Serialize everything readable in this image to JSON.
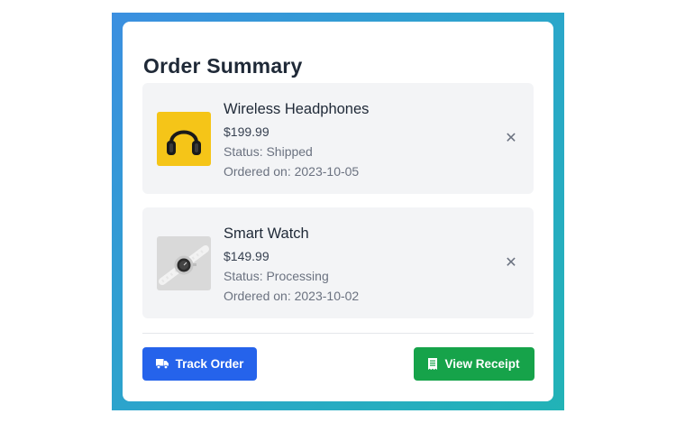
{
  "order_summary": {
    "title": "Order Summary",
    "items": [
      {
        "name": "Wireless Headphones",
        "price": "$199.99",
        "status": "Status: Shipped",
        "ordered_on": "Ordered on: 2023-10-05",
        "image_icon": "headphones-image",
        "remove_icon": "close-icon"
      },
      {
        "name": "Smart Watch",
        "price": "$149.99",
        "status": "Status: Processing",
        "ordered_on": "Ordered on: 2023-10-02",
        "image_icon": "smartwatch-image",
        "remove_icon": "close-icon"
      }
    ],
    "remove_symbol": "✕"
  },
  "actions": {
    "track_label": "Track Order",
    "track_icon": "truck-icon",
    "receipt_label": "View Receipt",
    "receipt_icon": "receipt-icon"
  },
  "colors": {
    "frame_gradient_start": "#3b8fe0",
    "frame_gradient_end": "#22b3b6",
    "track_button": "#2563eb",
    "receipt_button": "#16a34a",
    "item_background": "#f3f4f6",
    "headphones_background": "#f5c518"
  }
}
